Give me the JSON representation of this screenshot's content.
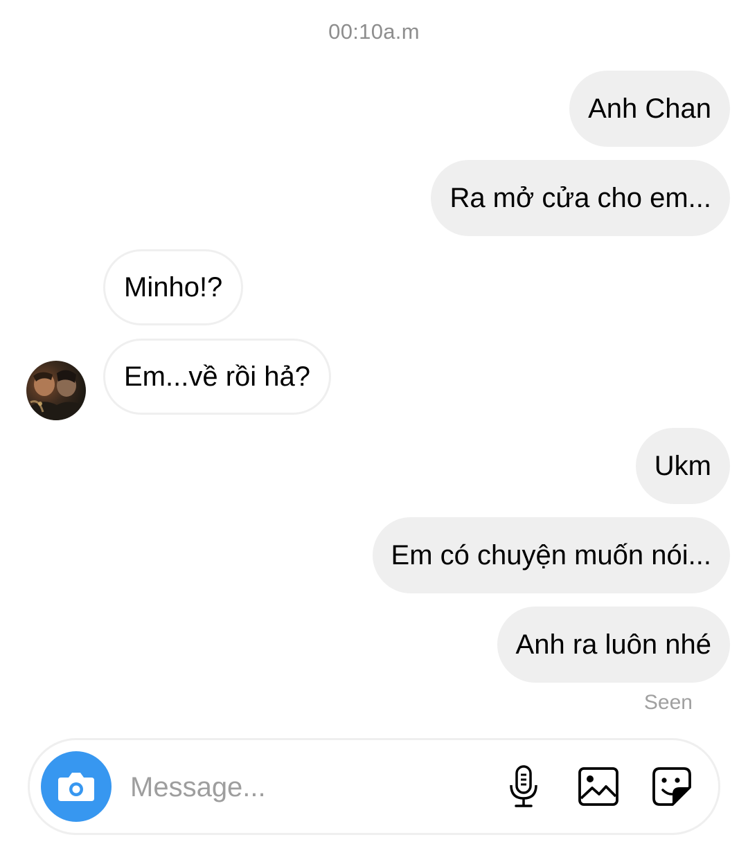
{
  "timestamp": "00:10a.m",
  "messages": [
    {
      "side": "out",
      "text": "Anh Chan"
    },
    {
      "side": "out",
      "text": "Ra mở cửa cho em..."
    },
    {
      "side": "in",
      "text": "Minho!?"
    },
    {
      "side": "in",
      "text": "Em...về rồi hả?"
    },
    {
      "side": "out",
      "text": "Ukm"
    },
    {
      "side": "out",
      "text": "Em có chuyện muốn nói..."
    },
    {
      "side": "out",
      "text": "Anh ra luôn nhé"
    }
  ],
  "status": {
    "seen_label": "Seen"
  },
  "composer": {
    "placeholder": "Message...",
    "value": "",
    "icons": {
      "camera": "camera-icon",
      "mic": "microphone-icon",
      "gallery": "gallery-icon",
      "sticker": "sticker-icon"
    }
  },
  "colors": {
    "outgoing_bubble": "#efefef",
    "incoming_border": "#efefef",
    "accent": "#3797f0",
    "muted_text": "#8e8e8e"
  }
}
